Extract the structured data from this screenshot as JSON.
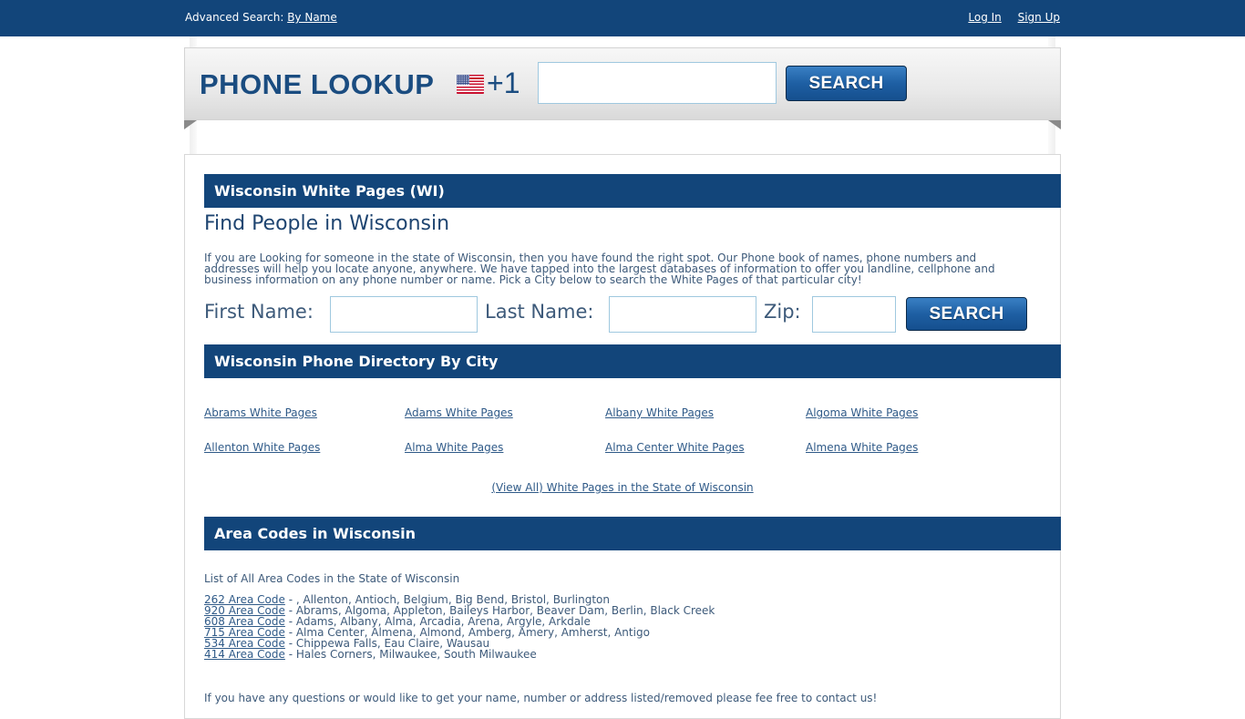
{
  "topbar": {
    "advanced_search_label": "Advanced Search:",
    "by_name_link": "By Name",
    "login_link": "Log In",
    "signup_link": "Sign Up"
  },
  "banner": {
    "brand": "PHONE LOOKUP",
    "flag_icon": "us-flag-icon",
    "country_code": "+1",
    "phone_input_value": "",
    "search_button": "SEARCH"
  },
  "white_pages": {
    "header": "Wisconsin White Pages (WI)",
    "title": "Find People in Wisconsin",
    "intro_lines": [
      "If you are Looking for someone in the state of Wisconsin, then you have found the right spot. Our Phone book of names, phone numbers and",
      "addresses will help you locate anyone, anywhere. We have tapped into the largest databases of information to offer you landline, cellphone and",
      "business information on any phone number or name. Pick a City below to search the White Pages of that particular city!"
    ],
    "form": {
      "first_name_label": "First Name:",
      "first_name_value": "",
      "last_name_label": "Last Name:",
      "last_name_value": "",
      "zip_label": "Zip:",
      "zip_value": "",
      "search_button": "SEARCH"
    }
  },
  "directory": {
    "header": "Wisconsin Phone Directory By City",
    "cities": [
      "Abrams White Pages",
      "Adams White Pages",
      "Albany White Pages",
      "Algoma White Pages",
      "Allenton White Pages",
      "Alma White Pages",
      "Alma Center White Pages",
      "Almena White Pages"
    ],
    "view_all": "(View All) White Pages in the State of Wisconsin"
  },
  "area_codes": {
    "header": "Area Codes in Wisconsin",
    "intro": "List of All Area Codes in the State of Wisconsin",
    "items": [
      {
        "code": "262 Area Code",
        "cities": " - , Allenton, Antioch, Belgium, Big Bend, Bristol, Burlington"
      },
      {
        "code": "920 Area Code",
        "cities": " - Abrams, Algoma, Appleton, Baileys Harbor, Beaver Dam, Berlin, Black Creek"
      },
      {
        "code": "608 Area Code",
        "cities": " - Adams, Albany, Alma, Arcadia, Arena, Argyle, Arkdale"
      },
      {
        "code": "715 Area Code",
        "cities": " - Alma Center, Almena, Almond, Amberg, Amery, Amherst, Antigo"
      },
      {
        "code": "534 Area Code",
        "cities": " - Chippewa Falls, Eau Claire, Wausau"
      },
      {
        "code": "414 Area Code",
        "cities": " - Hales Corners, Milwaukee, South Milwaukee"
      }
    ]
  },
  "footer_note": "If you have any questions or would like to get your name, number or address listed/removed please fee free to contact us!",
  "colors": {
    "brand_blue": "#12457a",
    "link_blue": "#2f5a88",
    "text": "#3d5a7a"
  }
}
